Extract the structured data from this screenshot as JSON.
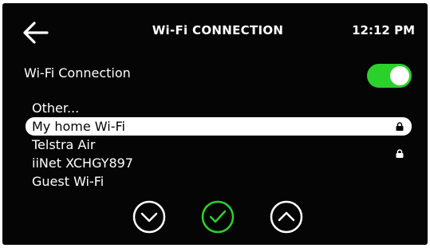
{
  "header": {
    "back_icon": "arrow-left-icon",
    "title": "Wi-Fi CONNECTION",
    "time": "12:12 PM"
  },
  "wifi": {
    "label": "Wi-Fi Connection",
    "enabled": true,
    "toggle_color": "#2bd12b"
  },
  "networks": [
    {
      "name": "Other...",
      "locked": false,
      "selected": false
    },
    {
      "name": "My home Wi-Fi",
      "locked": true,
      "selected": true
    },
    {
      "name": "Telstra Air",
      "locked": false,
      "selected": false
    },
    {
      "name": "iiNet XCHGY897",
      "locked": true,
      "selected": false
    },
    {
      "name": "Guest Wi-Fi",
      "locked": false,
      "selected": false
    }
  ],
  "controls": {
    "down_icon": "chevron-down-circle-icon",
    "confirm_icon": "check-circle-icon",
    "up_icon": "chevron-up-circle-icon",
    "confirm_color": "#2bd12b"
  },
  "colors": {
    "background": "#050505",
    "foreground": "#ffffff",
    "accent": "#2bd12b"
  }
}
